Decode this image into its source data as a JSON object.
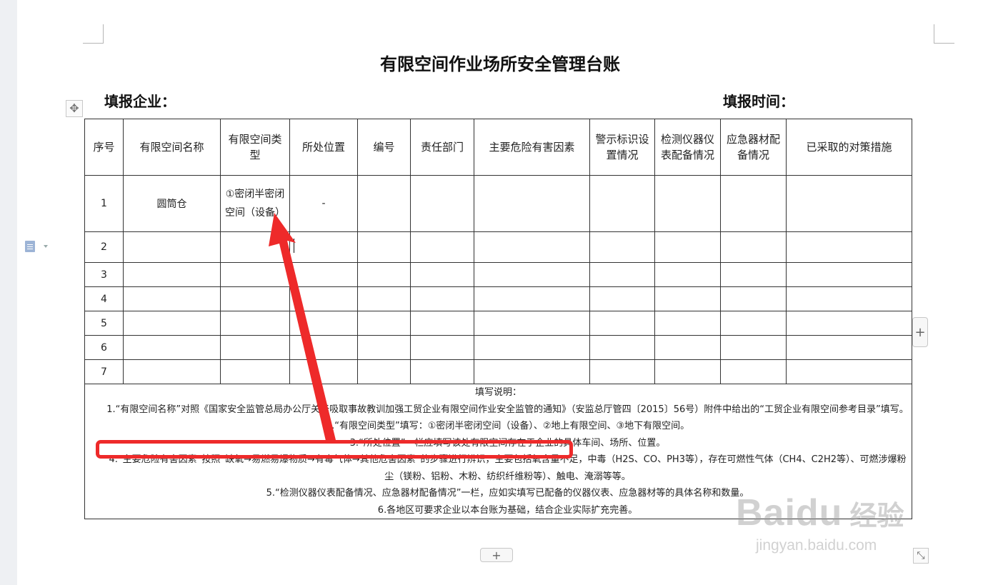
{
  "document": {
    "title": "有限空间作业场所安全管理台账",
    "fill_company_label": "填报企业：",
    "fill_time_label": "填报时间："
  },
  "table": {
    "headers": [
      "序号",
      "有限空间名称",
      "有限空间类型",
      "所处位置",
      "编号",
      "责任部门",
      "主要危险有害因素",
      "警示标识设置情况",
      "检测仪器仪表配备情况",
      "应急器材配备情况",
      "已采取的对策措施"
    ],
    "rows": [
      [
        "1",
        "圆筒仓",
        "①密闭半密闭空间（设备）",
        "-",
        "",
        "",
        "",
        "",
        "",
        "",
        ""
      ],
      [
        "2",
        "",
        "",
        "",
        "",
        "",
        "",
        "",
        "",
        "",
        ""
      ],
      [
        "3",
        "",
        "",
        "",
        "",
        "",
        "",
        "",
        "",
        "",
        ""
      ],
      [
        "4",
        "",
        "",
        "",
        "",
        "",
        "",
        "",
        "",
        "",
        ""
      ],
      [
        "5",
        "",
        "",
        "",
        "",
        "",
        "",
        "",
        "",
        "",
        ""
      ],
      [
        "6",
        "",
        "",
        "",
        "",
        "",
        "",
        "",
        "",
        "",
        ""
      ],
      [
        "7",
        "",
        "",
        "",
        "",
        "",
        "",
        "",
        "",
        "",
        ""
      ]
    ]
  },
  "notes": {
    "heading": "填写说明：",
    "items": [
      "1.“有限空间名称”对照《国家安全监管总局办公厅关于吸取事故教训加强工贸企业有限空间作业安全监管的通知》（安监总厅管四〔2015〕56号）附件中给出的“工贸企业有限空间参考目录”填写。",
      "2.“有限空间类型”填写：①密闭半密闭空间（设备）、②地上有限空间、③地下有限空间。",
      "3.“所处位置”一栏应填写该处有限空间存在于企业的具体车间、场所、位置。",
      "4.“主要危险有害因素”按照“缺氧→易燃易爆物质→有毒气体→其他危害因素”的步骤进行辨识，主要包括氧含量不足，中毒（H2S、CO、PH3等），存在可燃性气体（CH4、C2H2等）、可燃涉爆粉尘（镁粉、铝粉、木粉、纺织纤维粉等）、触电、淹溺等等。",
      "5.“检测仪器仪表配备情况、应急器材配备情况”一栏，应如实填写已配备的仪器仪表、应急器材等的具体名称和数量。",
      "6.各地区可要求企业以本台账为基础，结合企业实际扩充完善。"
    ]
  },
  "controls": {
    "add_column_glyph": "+",
    "add_row_glyph": "+",
    "move_glyph": "✥",
    "resize_glyph": "⤡"
  },
  "icons": {
    "move_handle": "move-icon",
    "doc_side": "document-icon",
    "resize": "resize-icon"
  },
  "watermark": {
    "brand": "Bai",
    "brand_suffix": "du",
    "cn": "经验",
    "url": "jingyan.baidu.com"
  },
  "colors": {
    "annotation_red": "#ee2a2a",
    "table_border": "#333333",
    "canvas": "#eef0f3"
  }
}
